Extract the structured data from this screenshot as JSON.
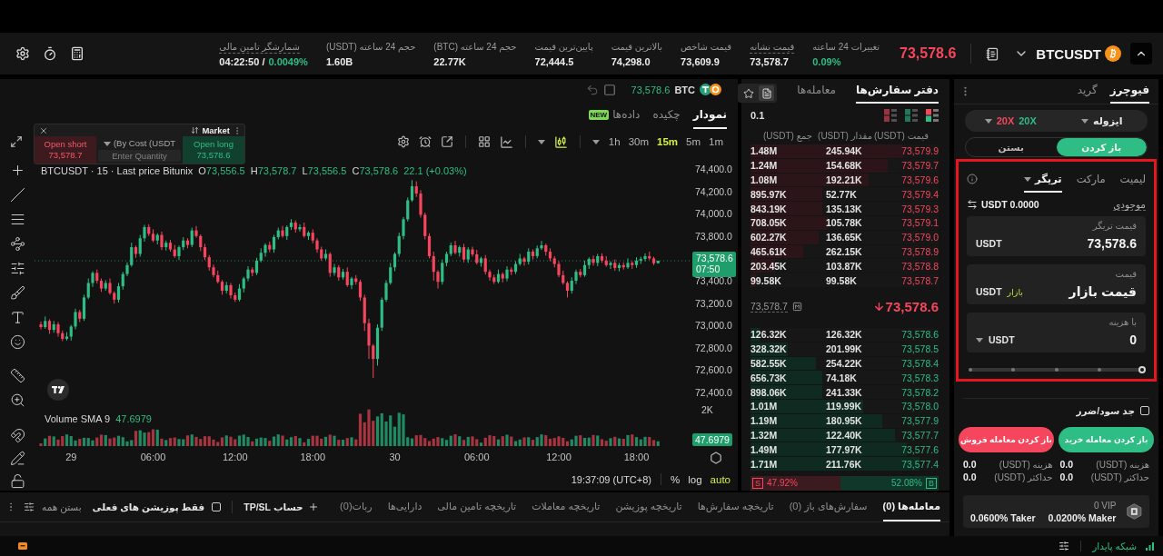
{
  "header": {
    "symbol": "BTCUSDT",
    "price": "73,578.6",
    "falling": true,
    "stats": {
      "funding_countdown": {
        "label": "شمارشگر تامین مالی",
        "value": "04:22:50 /",
        "rate": "0.0049%",
        "underlined": true
      },
      "volume_usdt": {
        "label": "حجم 24 ساعته (USDT)",
        "value": "1.60B",
        "underlined": false
      },
      "volume_btc": {
        "label": "حجم 24 ساعته (BTC)",
        "value": "22.77K",
        "underlined": false
      },
      "low_price": {
        "label": "پایین‌ترین قیمت",
        "value": "72,444.5",
        "underlined": false
      },
      "high_price": {
        "label": "بالاترین قیمت",
        "value": "74,298.0",
        "underlined": false
      },
      "index_price": {
        "label": "قیمت شاخص",
        "value": "73,609.9",
        "underlined": false
      },
      "mark_price": {
        "label": "قیمت نشانه",
        "value": "73,578.7",
        "underlined": true
      },
      "change_24h": {
        "label": "تغییرات 24 ساعته",
        "value": "0.09%",
        "rising": true,
        "underlined": false
      }
    }
  },
  "chart_panel": {
    "ticker": {
      "coin": "BTC",
      "price": "73,578.6"
    },
    "tabs": [
      {
        "label": "نمودار",
        "selected": true
      },
      {
        "label": "چکیده",
        "selected": false
      },
      {
        "label": "داده‌ها",
        "selected": false,
        "badge": "NEW"
      }
    ],
    "intervals": [
      {
        "label": "1h",
        "selected": false
      },
      {
        "label": "30m",
        "selected": false
      },
      {
        "label": "15m",
        "selected": true
      },
      {
        "label": "5m",
        "selected": false
      },
      {
        "label": "1m",
        "selected": false
      }
    ],
    "quick_order": {
      "title": "Market",
      "short": {
        "label": "Open short",
        "price": "73,578.7"
      },
      "mode": "(By Cost (USDT",
      "placeholder": "Enter Quantity",
      "long": {
        "label": "Open long",
        "price": "73,578.6"
      }
    },
    "legend": {
      "title": "BTCUSDT · 15 · Last price Bitunix",
      "ohlc": [
        {
          "key": "O",
          "value": "73,556.5"
        },
        {
          "key": "H",
          "value": "73,578.7"
        },
        {
          "key": "L",
          "value": "73,556.5"
        },
        {
          "key": "C",
          "value": "73,578.6"
        }
      ],
      "change": "22.1 (+0.03%)"
    },
    "chart_data": {
      "type": "candlestick",
      "categories": [
        null,
        null,
        null,
        null,
        null,
        null,
        null,
        "29",
        null,
        null,
        null,
        null,
        null,
        null,
        null,
        null,
        null,
        null,
        null,
        null,
        null,
        null,
        null,
        null,
        null,
        null,
        "06:00",
        null,
        null,
        null,
        null,
        null,
        null,
        null,
        null,
        null,
        null,
        null,
        null,
        null,
        null,
        null,
        null,
        null,
        null,
        "12:00",
        null,
        null,
        null,
        null,
        null,
        null,
        null,
        null,
        null,
        null,
        null,
        null,
        null,
        null,
        null,
        null,
        null,
        "18:00",
        null,
        null,
        null,
        null,
        null,
        null,
        null,
        null,
        null,
        null,
        null,
        null,
        null,
        null,
        null,
        null,
        null,
        null,
        "30",
        null,
        null,
        null,
        null,
        null,
        null,
        null,
        null,
        null,
        null,
        null,
        null,
        null,
        null,
        null,
        null,
        null,
        null,
        "06:00",
        null,
        null,
        null,
        null,
        null,
        null,
        null,
        null,
        null,
        null,
        null,
        null,
        null,
        null,
        null,
        null,
        null,
        null,
        "12:00",
        null,
        null,
        null,
        null,
        null,
        null,
        null,
        null,
        null,
        null,
        null,
        null,
        null,
        null,
        null,
        null,
        null,
        "18:00",
        null,
        null,
        null,
        null,
        null
      ],
      "ohlc": [
        [
          73010,
          73035,
          72965,
          72985
        ],
        [
          72985,
          73080,
          72970,
          73040
        ],
        [
          73040,
          73055,
          72925,
          72960
        ],
        [
          72960,
          73040,
          72935,
          73010
        ],
        [
          73010,
          73030,
          72900,
          72930
        ],
        [
          72930,
          72955,
          72860,
          72880
        ],
        [
          72880,
          72940,
          72865,
          72900
        ],
        [
          72900,
          73005,
          72865,
          72990
        ],
        [
          72990,
          73150,
          72965,
          73120
        ],
        [
          73120,
          73140,
          73030,
          73060
        ],
        [
          73060,
          73275,
          73040,
          73250
        ],
        [
          73250,
          73420,
          73235,
          73380
        ],
        [
          73380,
          73485,
          73345,
          73470
        ],
        [
          73470,
          73500,
          73375,
          73400
        ],
        [
          73400,
          73420,
          73300,
          73330
        ],
        [
          73330,
          73405,
          73310,
          73380
        ],
        [
          73380,
          73420,
          73275,
          73290
        ],
        [
          73290,
          73305,
          73195,
          73230
        ],
        [
          73230,
          73380,
          73205,
          73350
        ],
        [
          73350,
          73480,
          73320,
          73460
        ],
        [
          73460,
          73565,
          73440,
          73540
        ],
        [
          73540,
          73740,
          73525,
          73700
        ],
        [
          73700,
          73715,
          73605,
          73640
        ],
        [
          73640,
          73810,
          73615,
          73780
        ],
        [
          73780,
          73900,
          73750,
          73880
        ],
        [
          73880,
          73905,
          73800,
          73820
        ],
        [
          73820,
          73860,
          73745,
          73760
        ],
        [
          73760,
          73825,
          73725,
          73810
        ],
        [
          73810,
          73840,
          73675,
          73700
        ],
        [
          73700,
          73760,
          73670,
          73740
        ],
        [
          73740,
          73765,
          73660,
          73680
        ],
        [
          73680,
          73720,
          73605,
          73620
        ],
        [
          73620,
          73715,
          73585,
          73700
        ],
        [
          73700,
          73790,
          73675,
          73760
        ],
        [
          73760,
          73780,
          73690,
          73720
        ],
        [
          73720,
          73875,
          73700,
          73850
        ],
        [
          73850,
          73890,
          73785,
          73800
        ],
        [
          73800,
          73815,
          73665,
          73700
        ],
        [
          73700,
          73730,
          73585,
          73610
        ],
        [
          73610,
          73630,
          73490,
          73520
        ],
        [
          73520,
          73545,
          73430,
          73450
        ],
        [
          73450,
          73490,
          73375,
          73390
        ],
        [
          73390,
          73405,
          73275,
          73310
        ],
        [
          73310,
          73390,
          73285,
          73360
        ],
        [
          73360,
          73380,
          73240,
          73270
        ],
        [
          73270,
          73295,
          73210,
          73230
        ],
        [
          73230,
          73370,
          73215,
          73330
        ],
        [
          73330,
          73435,
          73295,
          73420
        ],
        [
          73420,
          73530,
          73395,
          73500
        ],
        [
          73500,
          73520,
          73440,
          73470
        ],
        [
          73470,
          73605,
          73450,
          73580
        ],
        [
          73580,
          73690,
          73565,
          73650
        ],
        [
          73650,
          73735,
          73615,
          73720
        ],
        [
          73720,
          73750,
          73655,
          73680
        ],
        [
          73680,
          73810,
          73650,
          73790
        ],
        [
          73790,
          73875,
          73770,
          73850
        ],
        [
          73850,
          73890,
          73785,
          73800
        ],
        [
          73800,
          73895,
          73765,
          73880
        ],
        [
          73880,
          73950,
          73855,
          73920
        ],
        [
          73920,
          73940,
          73830,
          73860
        ],
        [
          73860,
          73905,
          73840,
          73880
        ],
        [
          73880,
          73920,
          73785,
          73800
        ],
        [
          73800,
          73845,
          73765,
          73830
        ],
        [
          73830,
          73860,
          73735,
          73760
        ],
        [
          73760,
          73780,
          73650,
          73680
        ],
        [
          73680,
          73705,
          73580,
          73600
        ],
        [
          73600,
          73680,
          73585,
          73640
        ],
        [
          73640,
          73655,
          73435,
          73470
        ],
        [
          73470,
          73550,
          73445,
          73520
        ],
        [
          73520,
          73540,
          73400,
          73430
        ],
        [
          73430,
          73505,
          73410,
          73480
        ],
        [
          73480,
          73520,
          73345,
          73360
        ],
        [
          73360,
          73435,
          73325,
          73420
        ],
        [
          73420,
          73450,
          73365,
          73390
        ],
        [
          73390,
          73410,
          73220,
          73250
        ],
        [
          73250,
          73275,
          72950,
          73020
        ],
        [
          73020,
          73060,
          72700,
          72820
        ],
        [
          72820,
          72835,
          72530,
          72700
        ],
        [
          72700,
          73010,
          72640,
          72980
        ],
        [
          72980,
          73250,
          72950,
          73230
        ],
        [
          73230,
          73405,
          73210,
          73380
        ],
        [
          73380,
          73560,
          73365,
          73520
        ],
        [
          73520,
          73655,
          73485,
          73640
        ],
        [
          73640,
          73830,
          73615,
          73800
        ],
        [
          73800,
          73970,
          73770,
          73950
        ],
        [
          73950,
          74145,
          73930,
          74120
        ],
        [
          74120,
          74300,
          74105,
          74245
        ],
        [
          74245,
          74290,
          74150,
          74180
        ],
        [
          74180,
          74210,
          73965,
          73990
        ],
        [
          73990,
          74010,
          73770,
          73800
        ],
        [
          73800,
          73825,
          73600,
          73620
        ],
        [
          73620,
          73660,
          73400,
          73480
        ],
        [
          73480,
          73495,
          73330,
          73390
        ],
        [
          73390,
          73590,
          73365,
          73560
        ],
        [
          73560,
          73660,
          73530,
          73640
        ],
        [
          73640,
          73742,
          73620,
          73717
        ],
        [
          73717,
          73757,
          73635,
          73650
        ],
        [
          73650,
          73715,
          73615,
          73700
        ],
        [
          73700,
          73730,
          73565,
          73590
        ],
        [
          73590,
          73700,
          73560,
          73680
        ],
        [
          73680,
          73705,
          73616,
          73636
        ],
        [
          73636,
          73676,
          73545,
          73560
        ],
        [
          73560,
          73615,
          73525,
          73600
        ],
        [
          73600,
          73630,
          73455,
          73480
        ],
        [
          73480,
          73500,
          73400,
          73430
        ],
        [
          73430,
          73455,
          73370,
          73390
        ],
        [
          73390,
          73500,
          73375,
          73460
        ],
        [
          73460,
          73475,
          73385,
          73420
        ],
        [
          73420,
          73530,
          73395,
          73500
        ],
        [
          73500,
          73520,
          73450,
          73480
        ],
        [
          73480,
          73575,
          73460,
          73550
        ],
        [
          73550,
          73640,
          73535,
          73600
        ],
        [
          73600,
          73615,
          73535,
          73570
        ],
        [
          73570,
          73690,
          73545,
          73660
        ],
        [
          73660,
          73680,
          73590,
          73620
        ],
        [
          73620,
          73715,
          73600,
          73690
        ],
        [
          73690,
          73757,
          73675,
          73717
        ],
        [
          73717,
          73732,
          73625,
          73660
        ],
        [
          73660,
          73690,
          73575,
          73600
        ],
        [
          73600,
          73620,
          73520,
          73550
        ],
        [
          73550,
          73575,
          73430,
          73450
        ],
        [
          73450,
          73490,
          73365,
          73380
        ],
        [
          73380,
          73395,
          73250,
          73310
        ],
        [
          73310,
          73430,
          73285,
          73400
        ],
        [
          73400,
          73500,
          73370,
          73480
        ],
        [
          73480,
          73505,
          73430,
          73450
        ],
        [
          73450,
          73580,
          73435,
          73540
        ],
        [
          73540,
          73610,
          73505,
          73595
        ],
        [
          73595,
          73625,
          73535,
          73560
        ],
        [
          73560,
          73640,
          73530,
          73620
        ],
        [
          73620,
          73645,
          73560,
          73580
        ],
        [
          73580,
          73620,
          73525,
          73540
        ],
        [
          73540,
          73575,
          73505,
          73560
        ],
        [
          73560,
          73590,
          73489,
          73514
        ],
        [
          73514,
          73560,
          73484,
          73540
        ],
        [
          73540,
          73565,
          73500,
          73520
        ],
        [
          73520,
          73600,
          73505,
          73560
        ],
        [
          73560,
          73575,
          73505,
          73540
        ],
        [
          73540,
          73610,
          73515,
          73580
        ],
        [
          73580,
          73615,
          73550,
          73595
        ],
        [
          73595,
          73645,
          73575,
          73620
        ],
        [
          73620,
          73660,
          73585,
          73600
        ],
        [
          73600,
          73615,
          73540,
          73556.5
        ],
        [
          73556.5,
          73578.7,
          73556.5,
          73578.6
        ]
      ],
      "ylim": [
        72400,
        74400
      ],
      "yticks": [
        {
          "value": 74400,
          "label": "74,400.0"
        },
        {
          "value": 74200,
          "label": "74,200.0"
        },
        {
          "value": 74000,
          "label": "74,000.0"
        },
        {
          "value": 73800,
          "label": "73,800.0"
        },
        {
          "value": 73400,
          "label": "73,400.0"
        },
        {
          "value": 73200,
          "label": "73,200.0"
        },
        {
          "value": 73000,
          "label": "73,000.0"
        },
        {
          "value": 72800,
          "label": "72,800.0"
        },
        {
          "value": 72600,
          "label": "72,600.0"
        },
        {
          "value": 72400,
          "label": "72,400.0"
        }
      ],
      "ref_lines": [
        {
          "axis": "y",
          "value": 73578.6,
          "label": "73,578.6"
        }
      ]
    },
    "last_price_tag": {
      "countdown": "07:50"
    },
    "volume": {
      "title": "Volume SMA 9",
      "value": "47.6979",
      "axis_label": "2K",
      "tag": "47.6979"
    },
    "clock": "19:37:09 (UTC+8)",
    "scale_options": [
      {
        "label": "%",
        "selected": false
      },
      {
        "label": "log",
        "selected": false
      },
      {
        "label": "auto",
        "selected": true
      }
    ]
  },
  "order_book": {
    "tabs": [
      {
        "label": "دفتر سفارش‌ها",
        "selected": true
      },
      {
        "label": "معامله‌ها",
        "selected": false
      }
    ],
    "tools": [
      {
        "kind": "document",
        "selected": true
      },
      {
        "kind": "star",
        "selected": false
      }
    ],
    "views": [
      {
        "kind": "both",
        "selected": true
      },
      {
        "kind": "bids",
        "selected": false
      },
      {
        "kind": "asks",
        "selected": false
      }
    ],
    "step": "0.1",
    "columns": [
      "جمع (USDT)",
      "مقدار (USDT)",
      "قیمت (USDT)"
    ],
    "asks": [
      {
        "price": "73,579.9",
        "amount": "245.94K",
        "total": "1.48M",
        "level": 0.81
      },
      {
        "price": "73,579.7",
        "amount": "154.68K",
        "total": "1.24M",
        "level": 0.73
      },
      {
        "price": "73,579.6",
        "amount": "192.21K",
        "total": "1.08M",
        "level": 0.63
      },
      {
        "price": "73,579.4",
        "amount": "52.77K",
        "total": "895.97K",
        "level": 0.38
      },
      {
        "price": "73,579.3",
        "amount": "135.13K",
        "total": "843.19K",
        "level": 0.38
      },
      {
        "price": "73,579.1",
        "amount": "105.78K",
        "total": "708.05K",
        "level": 0.41
      },
      {
        "price": "73,579.0",
        "amount": "136.65K",
        "total": "602.27K",
        "level": 0.36
      },
      {
        "price": "73,578.9",
        "amount": "262.15K",
        "total": "465.61K",
        "level": 0.28
      },
      {
        "price": "73,578.8",
        "amount": "103.87K",
        "total": "203.45K",
        "level": 0.13
      },
      {
        "price": "73,578.7",
        "amount": "99.58K",
        "total": "99.58K",
        "level": 0.03
      }
    ],
    "last": {
      "price": "73,578.6",
      "falling": true,
      "mark_price": "73,578.7"
    },
    "bids": [
      {
        "price": "73,578.6",
        "amount": "126.32K",
        "total": "126.32K",
        "level": 0.05
      },
      {
        "price": "73,578.5",
        "amount": "201.99K",
        "total": "328.32K",
        "level": 0.2
      },
      {
        "price": "73,578.4",
        "amount": "254.22K",
        "total": "582.55K",
        "level": 0.35
      },
      {
        "price": "73,578.3",
        "amount": "74.18K",
        "total": "656.73K",
        "level": 0.38
      },
      {
        "price": "73,578.2",
        "amount": "241.33K",
        "total": "898.06K",
        "level": 0.38
      },
      {
        "price": "73,578.0",
        "amount": "119.99K",
        "total": "1.01M",
        "level": 0.6
      },
      {
        "price": "73,577.9",
        "amount": "180.95K",
        "total": "1.19M",
        "level": 0.7
      },
      {
        "price": "73,577.7",
        "amount": "122.40K",
        "total": "1.32M",
        "level": 0.77
      },
      {
        "price": "73,577.6",
        "amount": "177.97K",
        "total": "1.49M",
        "level": 0.83
      },
      {
        "price": "73,577.4",
        "amount": "211.76K",
        "total": "1.71M",
        "level": 0.9
      }
    ],
    "ratio": {
      "sell_tag": "S",
      "sell": "47.92%",
      "buy": "52.08%",
      "buy_tag": "B",
      "level": 0.4792
    }
  },
  "positions_panel": {
    "tabs": [
      {
        "label": "معامله‌ها (0)",
        "selected": true
      },
      {
        "label": "سفارش‌های باز (0)",
        "selected": false
      },
      {
        "label": "تاریخچه سفارش‌ها",
        "selected": false
      },
      {
        "label": "تاریخچه پوزیشن",
        "selected": false
      },
      {
        "label": "تاریخچه معاملات",
        "selected": false
      },
      {
        "label": "تاریخچه تامین مالی",
        "selected": false
      },
      {
        "label": "دارایی‌ها",
        "selected": false
      },
      {
        "label": "ربات(0)",
        "selected": false
      }
    ],
    "add_tp_sl": "حساب TP/SL",
    "only_current": {
      "label": "فقط پوزیشن های فعلی",
      "checked": false
    },
    "close_all": "بستن همه"
  },
  "trade_panel": {
    "tabs": [
      {
        "label": "فیوچرز",
        "selected": true
      },
      {
        "label": "گرید",
        "selected": false
      }
    ],
    "margin_mode": "ایزوله",
    "leverage": [
      {
        "text": "20X",
        "color": "#f6465d"
      },
      {
        "text": "20X",
        "color": "#2ebd85"
      }
    ],
    "sides": [
      {
        "label": "باز کردن",
        "selected": true
      },
      {
        "label": "بستن",
        "selected": false
      }
    ],
    "order_form": {
      "highlighted": true,
      "order_types": [
        {
          "label": "لیمیت",
          "selected": false
        },
        {
          "label": "مارکت",
          "selected": false
        },
        {
          "label": "تریگر",
          "selected": true,
          "dropdown": true
        }
      ],
      "balance": {
        "label": "موجودی",
        "value": "USDT 0.0000"
      },
      "fields": [
        {
          "kind": "price",
          "label": "قیمت تریگر",
          "value": "73,578.6",
          "unit": "USDT"
        },
        {
          "kind": "market",
          "label": "قیمت",
          "value": "قیمت بازار",
          "tag": "بازار",
          "unit": "USDT"
        },
        {
          "kind": "amount",
          "label": "با هزینه",
          "value": "0",
          "unit": "USDT"
        }
      ],
      "slider": {
        "level": 0
      }
    },
    "tp_sl": {
      "label": "جد سود/ضرر",
      "checked": false
    },
    "actions": [
      {
        "kind": "buy",
        "label": "باز کردن معامله خرید"
      },
      {
        "kind": "sell",
        "label": "باز کردن معامله فروش"
      }
    ],
    "summary": [
      [
        {
          "label": "هزینه (USDT)",
          "value": "0.0"
        },
        {
          "label": "حداکثر (USDT)",
          "value": "0.0"
        }
      ],
      [
        {
          "label": "هزینه (USDT)",
          "value": "0.0"
        },
        {
          "label": "حداکثر (USDT)",
          "value": "0.0"
        }
      ]
    ],
    "vip": {
      "tier": "0 VIP",
      "maker": "0.0200% Maker",
      "taker": "0.0600% Taker"
    }
  },
  "status_bar": {
    "network": "شبکه پایدار"
  }
}
